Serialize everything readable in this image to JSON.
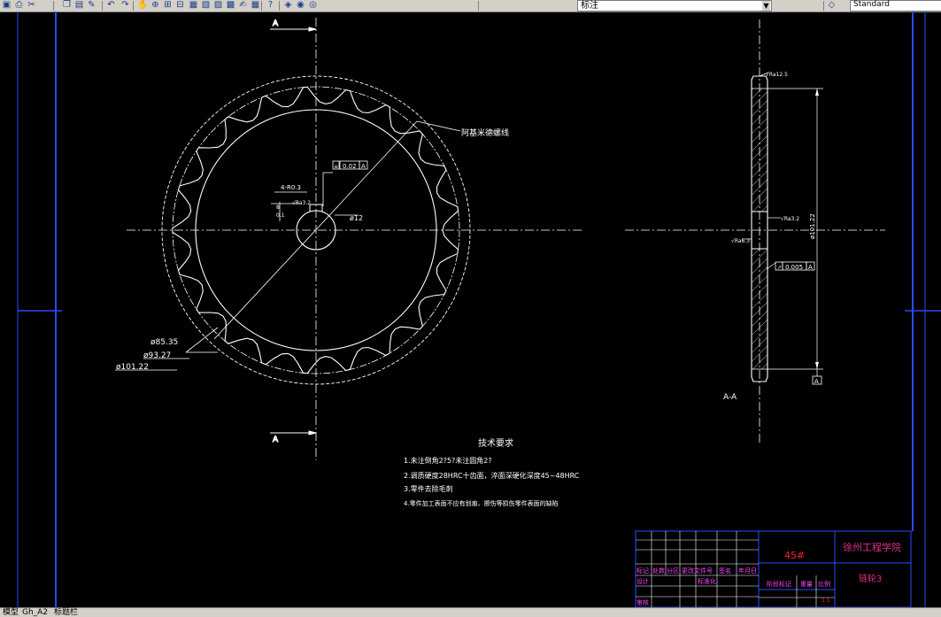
{
  "toolbar": {
    "layer_name": "标注",
    "text_style": "Standard",
    "icons": [
      "save-icon",
      "print-icon",
      "cut-icon",
      "copy-icon",
      "paste-icon",
      "match-properties-icon",
      "undo-icon",
      "redo-icon",
      "pan-icon",
      "zoom-realtime-icon",
      "zoom-window-icon",
      "zoom-previous-icon",
      "properties-icon",
      "design-center-icon",
      "tool-palettes-icon",
      "sheet-set-icon",
      "markup-icon",
      "calculator-icon",
      "help-icon",
      "layer-manager-icon",
      "layer-state-icon",
      "layer-previous-icon",
      "text-style-icon"
    ]
  },
  "drawing": {
    "section_label_top": "A",
    "section_label_bottom": "A",
    "leader_note": "阿基米德螺线",
    "tolerance_left": "0.02",
    "tolerance_left_datum": "A",
    "dim_keyway_depth": "4-R0.3",
    "dim_small_a": "8",
    "dim_small_b": "0.1",
    "dim_bore": "ø12",
    "dim_surface_left": "√Ra3.2",
    "dim_root_dia": "ø85.35",
    "dim_pitch_dia": "ø93.27",
    "dim_outer_dia": "ø101.22",
    "dim_face_finish": "√Ra12.5",
    "dim_hub_finish": "√Ra3.2",
    "dim_side_finish": "√Ra6.3",
    "dim_vertical": "ø101.22",
    "tolerance_right": "0.005",
    "tolerance_right_datum": "A",
    "datum_box": "A",
    "section_view_label": "A-A",
    "tech_title": "技术要求",
    "tech_lines": [
      "1.未注倒角2?5?未注圆角2?",
      "2.调质硬度28HRC十齿面，淬面深硬化深度45~48HRC",
      "3.零件去除毛刺",
      "4.零件加工表面不应有划痕、擦伤等损伤零件表面的缺陷"
    ]
  },
  "title_block": {
    "material": "45#",
    "school": "徐州工程学院",
    "part_name": "链轮3",
    "rev_headers": [
      "标记",
      "处数",
      "分区",
      "更改文件号",
      "签名",
      "年月日"
    ],
    "row_design": "设计",
    "row_standard": "标准化",
    "row_review": "审核",
    "stage_mark": "阶段标记",
    "weight": "重量",
    "scale": "比例",
    "scale_value": "1:1"
  },
  "layout_tabs": [
    "模型",
    "Gh_A2",
    "标题栏"
  ]
}
